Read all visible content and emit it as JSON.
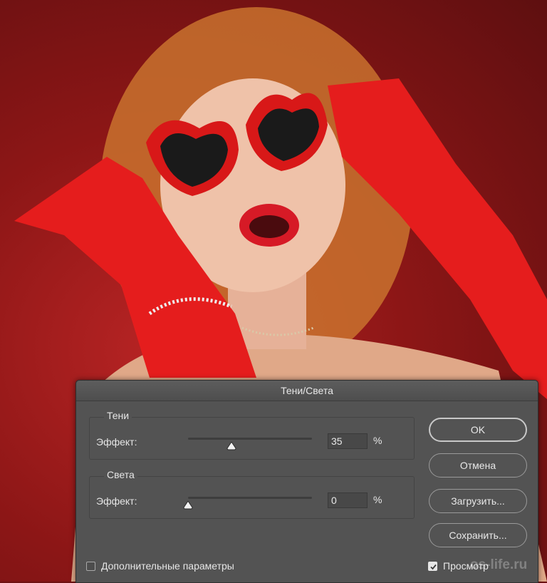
{
  "dialog": {
    "title": "Тени/Света",
    "shadows": {
      "legend": "Тени",
      "effect_label": "Эффект:",
      "value": "35",
      "unit": "%",
      "slider_fraction": 0.35
    },
    "highlights": {
      "legend": "Света",
      "effect_label": "Эффект:",
      "value": "0",
      "unit": "%",
      "slider_fraction": 0.0
    },
    "buttons": {
      "ok": "OK",
      "cancel": "Отмена",
      "load": "Загрузить...",
      "save": "Сохранить..."
    },
    "more_options": {
      "label": "Дополнительные параметры",
      "checked": false
    },
    "preview": {
      "label": "Просмотр",
      "checked": true
    }
  },
  "watermark": "os-life.ru",
  "colors": {
    "dialog_bg": "#535353",
    "photo_red": "#b82424",
    "glove_red": "#e51d1d"
  }
}
